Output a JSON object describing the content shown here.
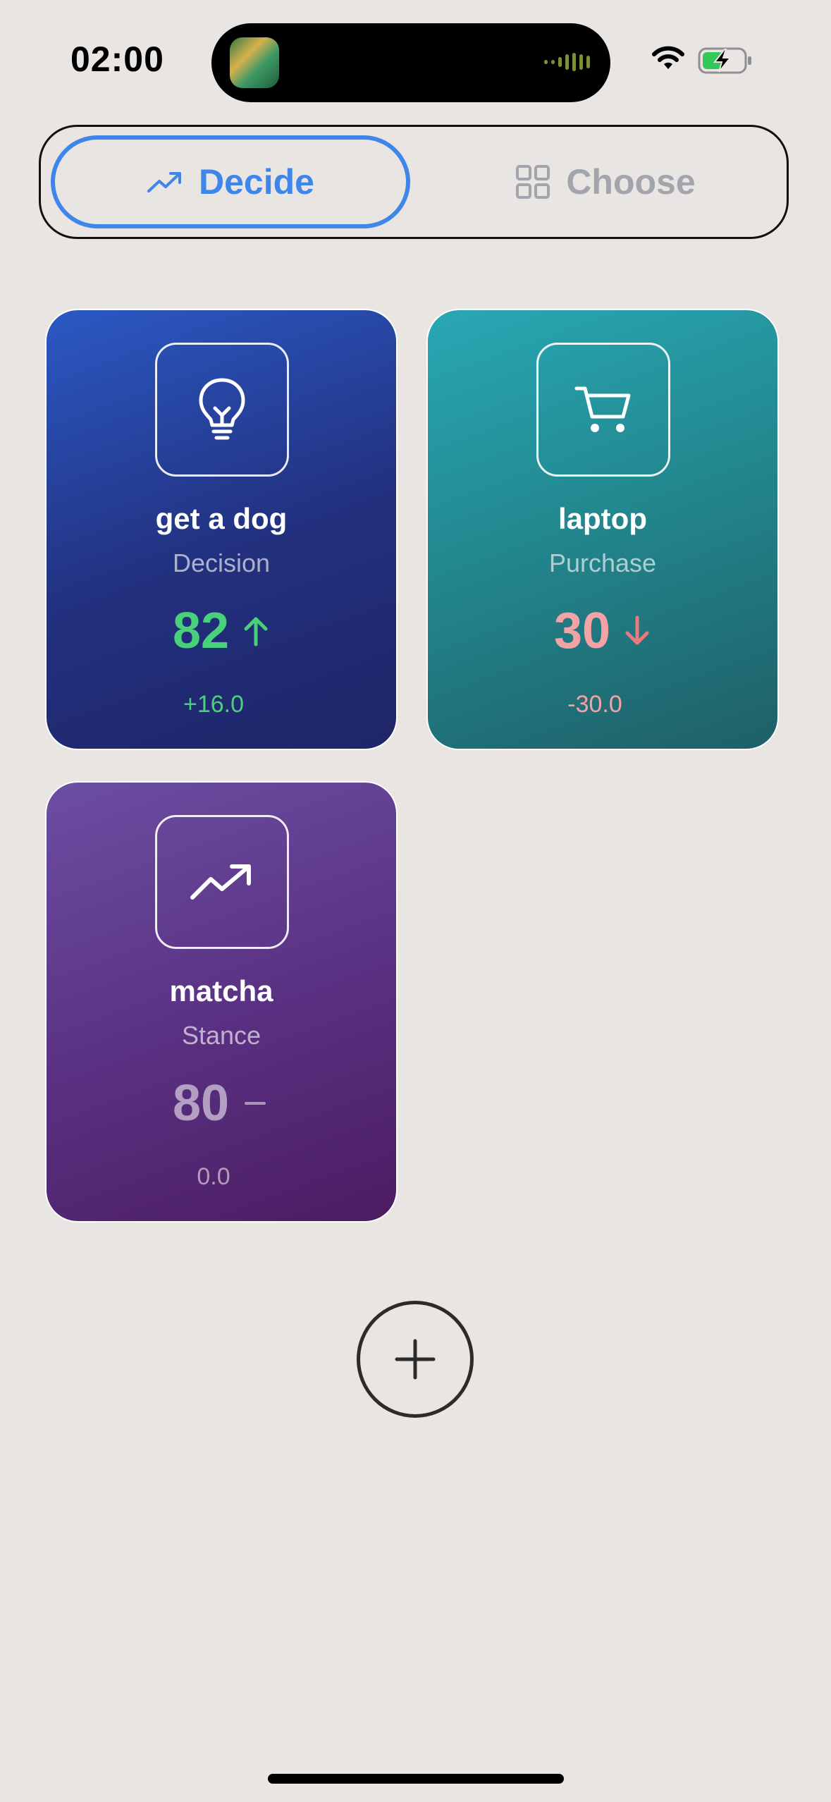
{
  "status_bar": {
    "time": "02:00",
    "icons": [
      "album-art-icon",
      "audio-bars-icon",
      "wifi-icon",
      "battery-charging-icon"
    ],
    "battery_color": "#34C759"
  },
  "tabs": [
    {
      "label": "Decide",
      "icon": "trend-up-icon",
      "active": true
    },
    {
      "label": "Choose",
      "icon": "grid-icon",
      "active": false
    }
  ],
  "cards": [
    {
      "title": "get a dog",
      "type": "Decision",
      "score": "82",
      "trend": "up",
      "delta": "+16.0",
      "icon": "lightbulb-icon",
      "colors": [
        "#2B59C3",
        "#1F2567"
      ]
    },
    {
      "title": "laptop",
      "type": "Purchase",
      "score": "30",
      "trend": "down",
      "delta": "-30.0",
      "icon": "cart-icon",
      "colors": [
        "#28A8B4",
        "#1F5F67"
      ]
    },
    {
      "title": "matcha",
      "type": "Stance",
      "score": "80",
      "trend": "flat",
      "delta": "0.0",
      "icon": "trend-up-icon",
      "colors": [
        "#6C4EA3",
        "#4C1C62"
      ]
    }
  ],
  "add_button": {
    "icon": "plus-icon"
  },
  "colors": {
    "accent": "#3F86EA",
    "positive": "#49D07B",
    "negative": "#F3A2A6",
    "background": "#E8E5E2"
  }
}
